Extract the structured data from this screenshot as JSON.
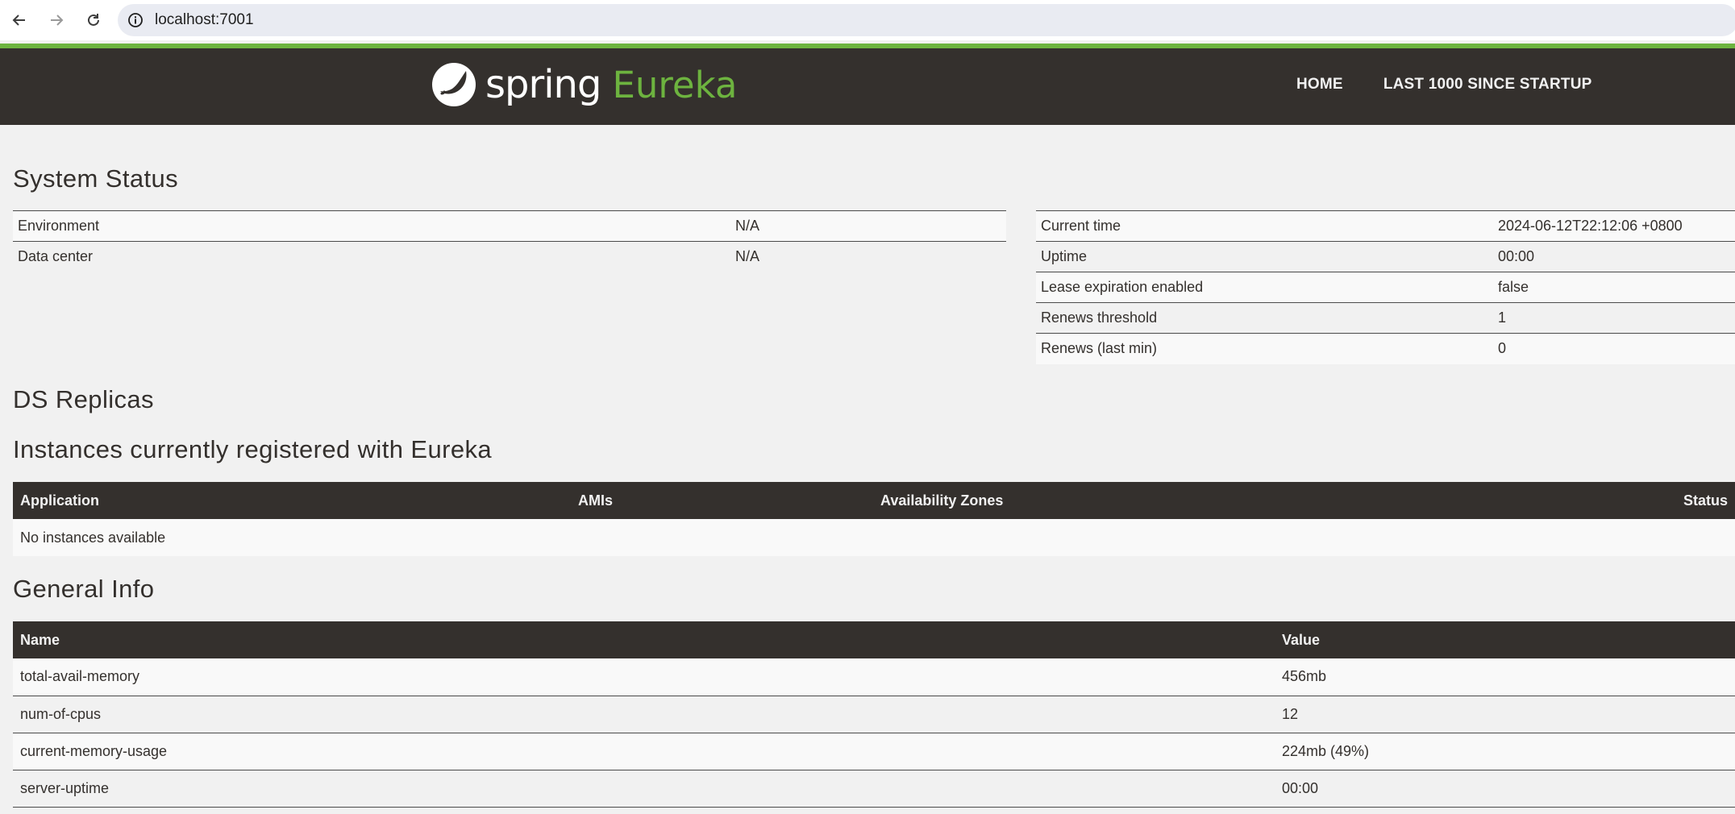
{
  "browser": {
    "url": "localhost:7001"
  },
  "navbar": {
    "brand_spring": "spring",
    "brand_eureka": "Eureka",
    "links": [
      "HOME",
      "LAST 1000 SINCE STARTUP"
    ]
  },
  "system_status": {
    "heading": "System Status",
    "left": [
      {
        "label": "Environment",
        "value": "N/A"
      },
      {
        "label": "Data center",
        "value": "N/A"
      }
    ],
    "right": [
      {
        "label": "Current time",
        "value": "2024-06-12T22:12:06 +0800"
      },
      {
        "label": "Uptime",
        "value": "00:00"
      },
      {
        "label": "Lease expiration enabled",
        "value": "false"
      },
      {
        "label": "Renews threshold",
        "value": "1"
      },
      {
        "label": "Renews (last min)",
        "value": "0"
      }
    ]
  },
  "ds_replicas": {
    "heading": "DS Replicas"
  },
  "instances": {
    "heading": "Instances currently registered with Eureka",
    "columns": [
      "Application",
      "AMIs",
      "Availability Zones",
      "Status"
    ],
    "empty_message": "No instances available"
  },
  "general_info": {
    "heading": "General Info",
    "columns": [
      "Name",
      "Value"
    ],
    "rows": [
      {
        "name": "total-avail-memory",
        "value": "456mb"
      },
      {
        "name": "num-of-cpus",
        "value": "12"
      },
      {
        "name": "current-memory-usage",
        "value": "224mb (49%)"
      },
      {
        "name": "server-uptime",
        "value": "00:00"
      }
    ]
  },
  "colors": {
    "brand_green": "#6db33f",
    "navbar_bg": "#34302d"
  }
}
